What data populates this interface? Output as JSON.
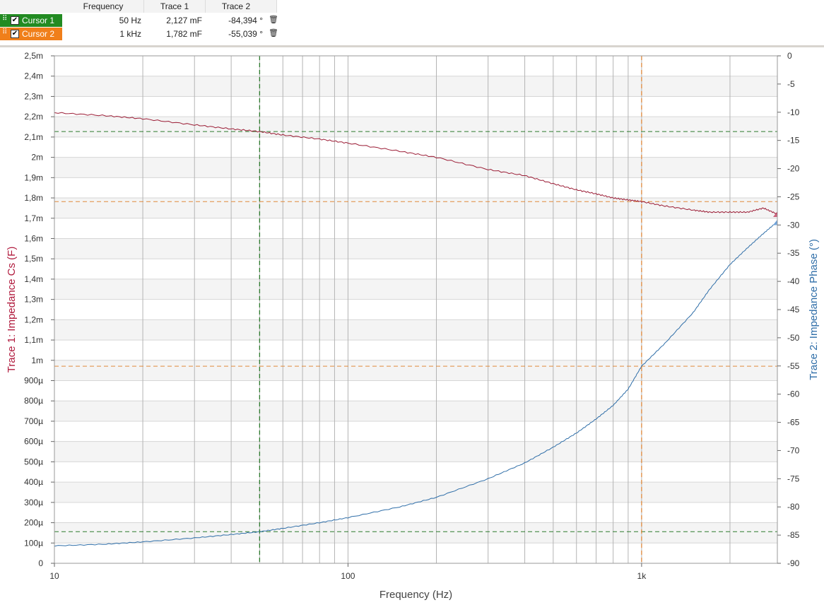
{
  "cursor_table": {
    "headers": [
      "Frequency",
      "Trace 1",
      "Trace 2"
    ],
    "rows": [
      {
        "label": "Cursor 1",
        "checked": true,
        "color": "#228b22",
        "frequency": "50 Hz",
        "trace1": "2,127 mF",
        "trace2": "-84,394 °"
      },
      {
        "label": "Cursor 2",
        "checked": true,
        "color": "#f07f1a",
        "frequency": "1 kHz",
        "trace1": "1,782 mF",
        "trace2": "-55,039 °"
      }
    ]
  },
  "icons": {
    "grip": "drag-grip-icon",
    "checkbox": "checkbox-icon",
    "delete": "trash-icon"
  },
  "chart_data": {
    "type": "line",
    "xlabel": "Frequency (Hz)",
    "xscale": "log",
    "xlim": [
      10,
      2900
    ],
    "x_tick_labels": [
      {
        "value": 10,
        "label": "10"
      },
      {
        "value": 100,
        "label": "100"
      },
      {
        "value": 1000,
        "label": "1k"
      }
    ],
    "y_left": {
      "label": "Trace 1: Impedance Cs (F)",
      "color": "#b0193c",
      "lim": [
        0,
        0.0025
      ],
      "tick_labels": [
        {
          "value": 0,
          "label": "0"
        },
        {
          "value": 0.0001,
          "label": "100µ"
        },
        {
          "value": 0.0002,
          "label": "200µ"
        },
        {
          "value": 0.0003,
          "label": "300µ"
        },
        {
          "value": 0.0004,
          "label": "400µ"
        },
        {
          "value": 0.0005,
          "label": "500µ"
        },
        {
          "value": 0.0006,
          "label": "600µ"
        },
        {
          "value": 0.0007,
          "label": "700µ"
        },
        {
          "value": 0.0008,
          "label": "800µ"
        },
        {
          "value": 0.0009,
          "label": "900µ"
        },
        {
          "value": 0.001,
          "label": "1m"
        },
        {
          "value": 0.0011,
          "label": "1,1m"
        },
        {
          "value": 0.0012,
          "label": "1,2m"
        },
        {
          "value": 0.0013,
          "label": "1,3m"
        },
        {
          "value": 0.0014,
          "label": "1,4m"
        },
        {
          "value": 0.0015,
          "label": "1,5m"
        },
        {
          "value": 0.0016,
          "label": "1,6m"
        },
        {
          "value": 0.0017,
          "label": "1,7m"
        },
        {
          "value": 0.0018,
          "label": "1,8m"
        },
        {
          "value": 0.0019,
          "label": "1,9m"
        },
        {
          "value": 0.002,
          "label": "2m"
        },
        {
          "value": 0.0021,
          "label": "2,1m"
        },
        {
          "value": 0.0022,
          "label": "2,2m"
        },
        {
          "value": 0.0023,
          "label": "2,3m"
        },
        {
          "value": 0.0024,
          "label": "2,4m"
        },
        {
          "value": 0.0025,
          "label": "2,5m"
        }
      ]
    },
    "y_right": {
      "label": "Trace 2: Impedance Phase (°)",
      "color": "#2f6ea8",
      "lim": [
        -90,
        0
      ],
      "tick_labels": [
        {
          "value": 0,
          "label": "0"
        },
        {
          "value": -5,
          "label": "-5"
        },
        {
          "value": -10,
          "label": "-10"
        },
        {
          "value": -15,
          "label": "-15"
        },
        {
          "value": -20,
          "label": "-20"
        },
        {
          "value": -25,
          "label": "-25"
        },
        {
          "value": -30,
          "label": "-30"
        },
        {
          "value": -35,
          "label": "-35"
        },
        {
          "value": -40,
          "label": "-40"
        },
        {
          "value": -45,
          "label": "-45"
        },
        {
          "value": -50,
          "label": "-50"
        },
        {
          "value": -55,
          "label": "-55"
        },
        {
          "value": -60,
          "label": "-60"
        },
        {
          "value": -65,
          "label": "-65"
        },
        {
          "value": -70,
          "label": "-70"
        },
        {
          "value": -75,
          "label": "-75"
        },
        {
          "value": -80,
          "label": "-80"
        },
        {
          "value": -85,
          "label": "-85"
        },
        {
          "value": -90,
          "label": "-90"
        }
      ]
    },
    "series": [
      {
        "axis": "left",
        "color": "#9b1c35",
        "x": [
          10,
          15,
          20,
          30,
          40,
          50,
          60,
          80,
          100,
          150,
          200,
          300,
          400,
          500,
          600,
          700,
          800,
          900,
          1000,
          1200,
          1500,
          1700,
          2000,
          2300,
          2600,
          2900
        ],
        "y": [
          0.00222,
          0.002205,
          0.00219,
          0.00216,
          0.00214,
          0.002127,
          0.00211,
          0.00209,
          0.00207,
          0.00203,
          0.002,
          0.00194,
          0.00191,
          0.00187,
          0.00184,
          0.00182,
          0.0018,
          0.00179,
          0.001782,
          0.00176,
          0.00174,
          0.00173,
          0.00173,
          0.00173,
          0.00175,
          0.00172
        ]
      },
      {
        "axis": "right",
        "color": "#2f6ea8",
        "x": [
          10,
          15,
          20,
          30,
          40,
          50,
          60,
          80,
          100,
          150,
          200,
          300,
          400,
          500,
          600,
          700,
          800,
          900,
          1000,
          1200,
          1500,
          1700,
          2000,
          2300,
          2600,
          2900
        ],
        "y": [
          -86.9,
          -86.6,
          -86.2,
          -85.5,
          -84.9,
          -84.394,
          -83.8,
          -82.8,
          -81.9,
          -80.0,
          -78.3,
          -75.0,
          -72.2,
          -69.4,
          -66.9,
          -64.4,
          -62.0,
          -59.1,
          -55.039,
          -51.0,
          -45.5,
          -41.5,
          -37.0,
          -34.0,
          -31.5,
          -29.4
        ]
      }
    ],
    "cursors": [
      {
        "name": "Cursor 1",
        "color": "#2c7a2c",
        "x": 50,
        "y_left": 0.002127,
        "y_right": -84.394
      },
      {
        "name": "Cursor 2",
        "color": "#e08a3c",
        "x": 1000,
        "y_left": 0.001782,
        "y_right": -55.039
      }
    ],
    "grid": true
  }
}
